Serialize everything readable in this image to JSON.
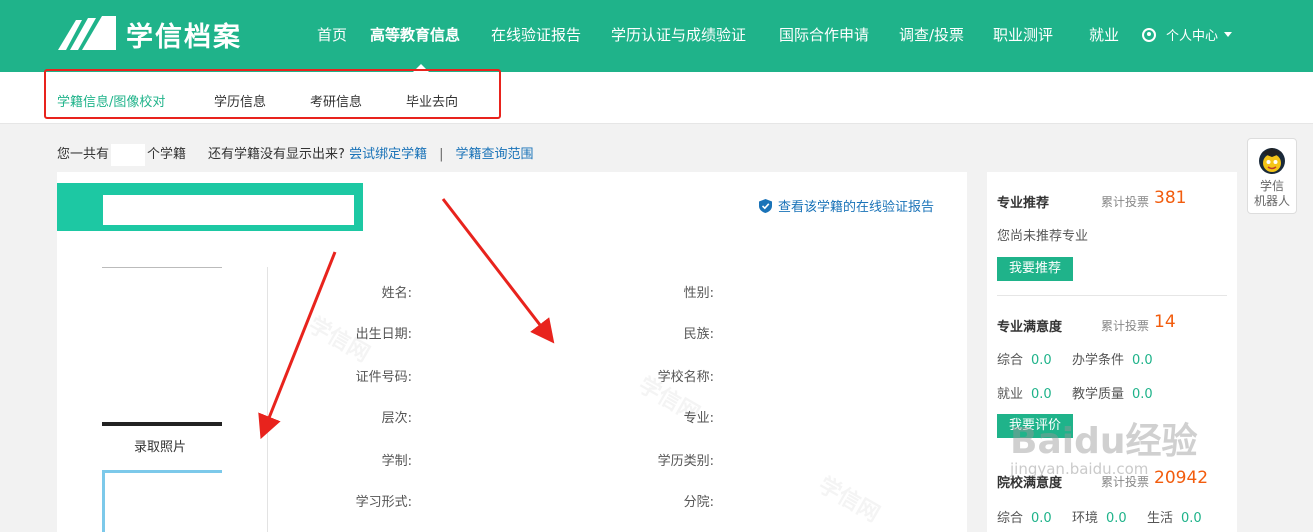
{
  "brand": {
    "name": "学信档案"
  },
  "nav": {
    "items": [
      {
        "label": "首页"
      },
      {
        "label": "高等教育信息",
        "active": true
      },
      {
        "label": "在线验证报告"
      },
      {
        "label": "学历认证与成绩验证"
      },
      {
        "label": "国际合作申请"
      },
      {
        "label": "调查/投票"
      },
      {
        "label": "职业测评"
      },
      {
        "label": "就业"
      }
    ],
    "user_center": "个人中心"
  },
  "subnav": {
    "items": [
      {
        "label": "学籍信息/图像校对",
        "active": true
      },
      {
        "label": "学历信息"
      },
      {
        "label": "考研信息"
      },
      {
        "label": "毕业去向"
      }
    ]
  },
  "info_line": {
    "prefix": "您一共有",
    "suffix": "个学籍",
    "question": "还有学籍没有显示出来?",
    "bind_link": "尝试绑定学籍",
    "separator": "|",
    "scope_link": "学籍查询范围"
  },
  "record": {
    "verify_link": "查看该学籍的在线验证报告",
    "photo_label": "录取照片",
    "fields_left": [
      "姓名:",
      "出生日期:",
      "证件号码:",
      "层次:",
      "学制:",
      "学习形式:"
    ],
    "fields_right": [
      "性别:",
      "民族:",
      "学校名称:",
      "专业:",
      "学历类别:",
      "分院:"
    ],
    "watermark": "学信网"
  },
  "sidebar": {
    "major_rec": {
      "title": "专业推荐",
      "votes_label": "累计投票",
      "votes": "381",
      "empty_text": "您尚未推荐专业",
      "button": "我要推荐"
    },
    "major_sat": {
      "title": "专业满意度",
      "votes_label": "累计投票",
      "votes": "14",
      "row1": [
        {
          "label": "综合",
          "value": "0.0"
        },
        {
          "label": "办学条件",
          "value": "0.0"
        }
      ],
      "row2": [
        {
          "label": "就业",
          "value": "0.0"
        },
        {
          "label": "教学质量",
          "value": "0.0"
        }
      ],
      "button": "我要评价"
    },
    "school_sat": {
      "title": "院校满意度",
      "votes_label": "累计投票",
      "votes": "20942",
      "row1": [
        {
          "label": "综合",
          "value": "0.0"
        },
        {
          "label": "环境",
          "value": "0.0"
        },
        {
          "label": "生活",
          "value": "0.0"
        }
      ]
    }
  },
  "robot": {
    "label_line1": "学信",
    "label_line2": "机器人"
  },
  "overlay_watermark": {
    "brand": "Baidu经验",
    "url": "jingyan.baidu.com"
  },
  "colors": {
    "brand_green": "#1fb38a",
    "head_teal": "#1dc8a3",
    "link_blue": "#1a73b8",
    "vote_orange": "#f25c0d",
    "annotation_red": "#e8231d"
  }
}
